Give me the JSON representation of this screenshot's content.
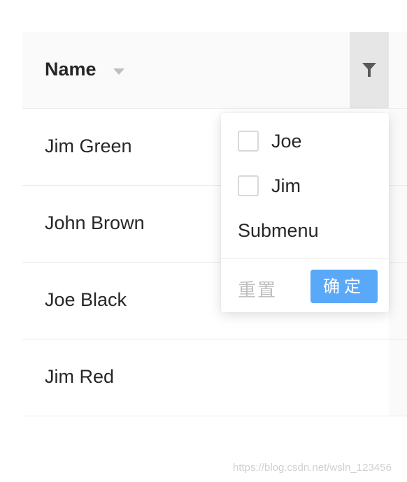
{
  "table": {
    "column_title": "Name",
    "rows": [
      {
        "name": "Jim Green"
      },
      {
        "name": "John Brown"
      },
      {
        "name": "Joe Black"
      },
      {
        "name": "Jim Red"
      }
    ]
  },
  "filter_dropdown": {
    "options": [
      {
        "label": "Joe",
        "checked": false
      },
      {
        "label": "Jim",
        "checked": false
      }
    ],
    "submenu_label": "Submenu",
    "reset_label": "重置",
    "confirm_label": "确定"
  },
  "watermark": "https://blog.csdn.net/wsln_123456",
  "colors": {
    "header_bg": "#fafafa",
    "filter_active_bg": "#e6e6e6",
    "primary": "#5aa8f8",
    "disabled_text": "#bfbfbf",
    "border": "#ececec"
  },
  "icons": {
    "filter": "filter-funnel-icon",
    "sort": "caret-down-icon"
  }
}
